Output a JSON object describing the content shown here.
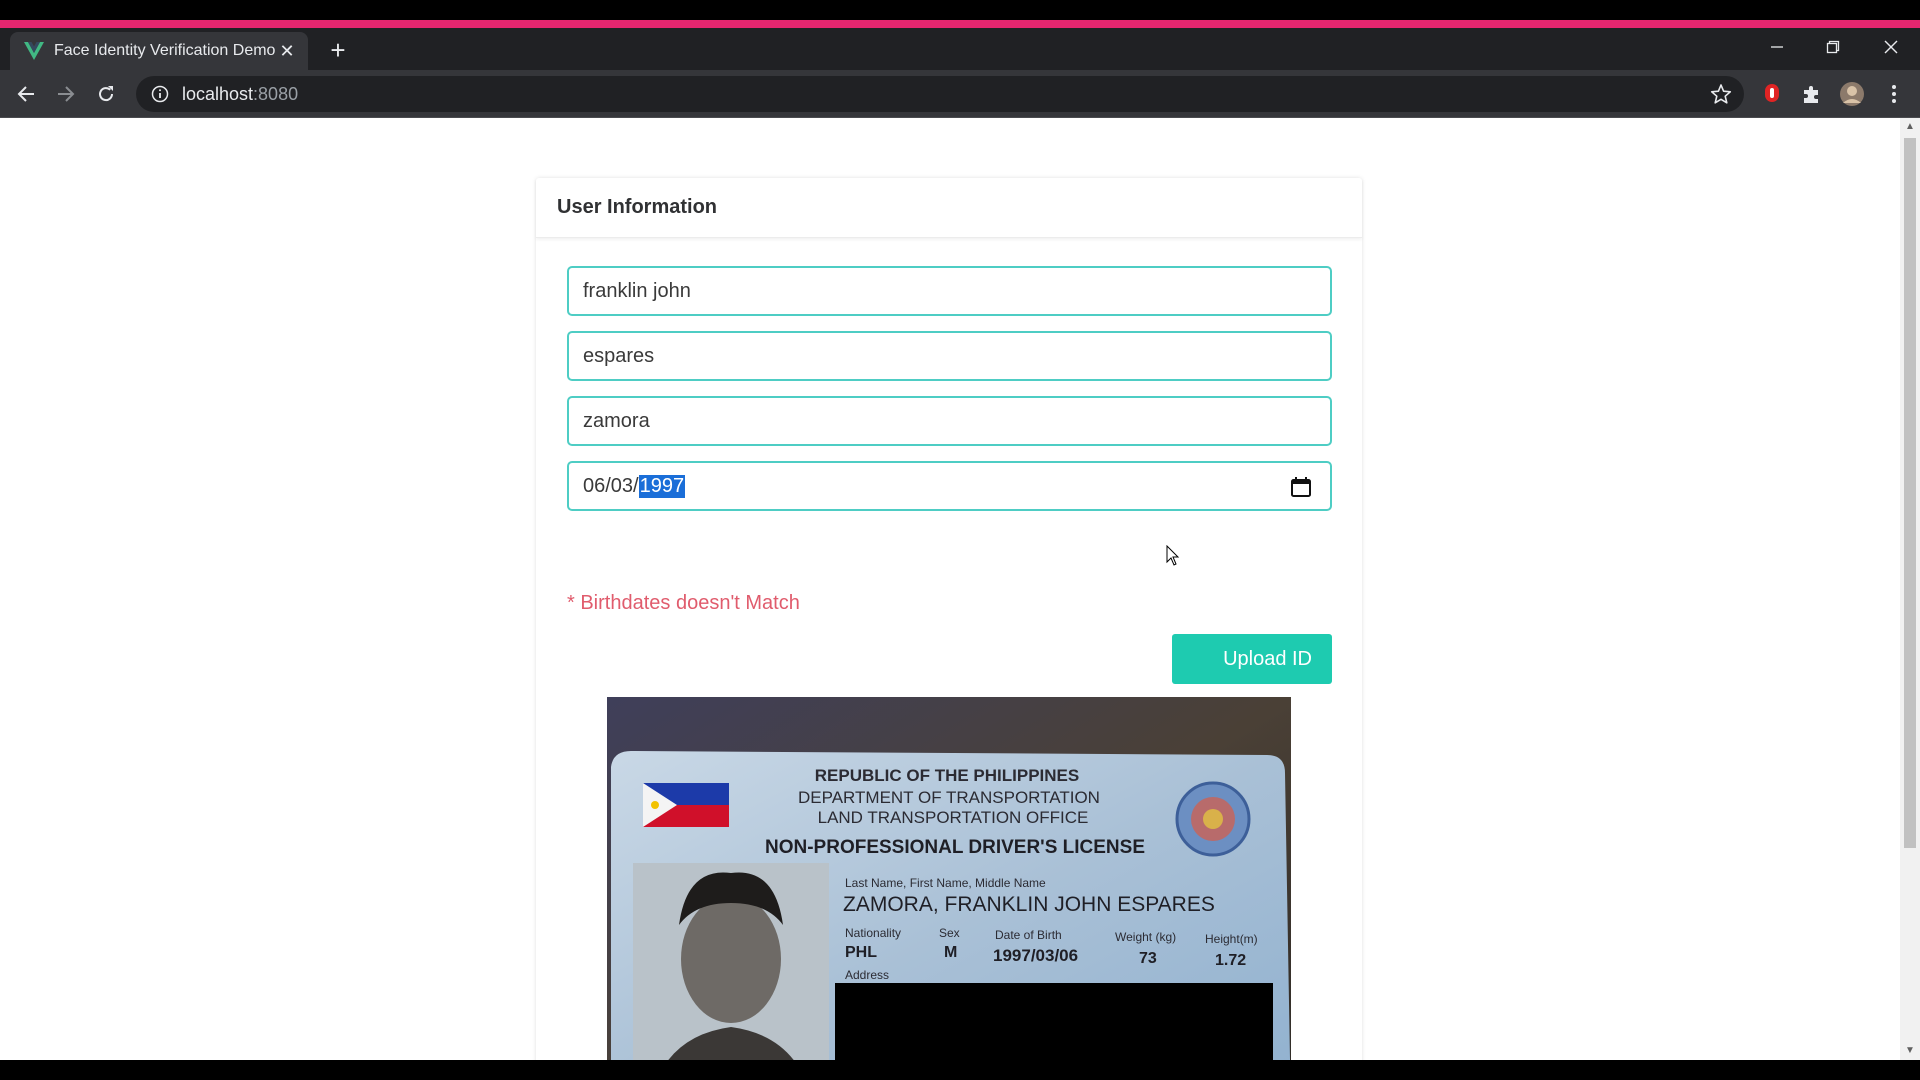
{
  "browser": {
    "tab_title": "Face Identity Verification Demo",
    "url_host": "localhost",
    "url_port": ":8080",
    "accent_color": "#e5266f"
  },
  "card": {
    "title": "User Information"
  },
  "form": {
    "first_name": "franklin john",
    "middle_name": "espares",
    "last_name": "zamora",
    "birthdate_prefix": "06/03/",
    "birthdate_year": "1997",
    "error_message": "* Birthdates doesn't Match",
    "upload_label": "Upload ID",
    "field_border_color": "#4ecdc4",
    "button_color": "#1ecbb0",
    "error_color": "#e05c6d"
  },
  "id_card": {
    "line1": "REPUBLIC OF THE PHILIPPINES",
    "line2": "DEPARTMENT OF TRANSPORTATION",
    "line3": "LAND TRANSPORTATION OFFICE",
    "license_type": "NON-PROFESSIONAL DRIVER'S LICENSE",
    "name_label": "Last Name, First Name, Middle Name",
    "name_value": "ZAMORA, FRANKLIN JOHN ESPARES",
    "nationality_label": "Nationality",
    "nationality_value": "PHL",
    "sex_label": "Sex",
    "sex_value": "M",
    "dob_label": "Date of Birth",
    "dob_value": "1997/03/06",
    "weight_label": "Weight (kg)",
    "weight_value": "73",
    "height_label": "Height(m)",
    "height_value": "1.72",
    "address_label": "Address"
  }
}
